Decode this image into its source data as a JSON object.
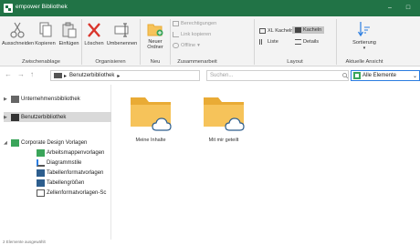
{
  "window": {
    "title": "empower Bibliothek",
    "controls": {
      "minimize": "–",
      "maximize": "□"
    }
  },
  "ribbon": {
    "clipboard": {
      "cut": "Ausschneiden",
      "copy": "Kopieren",
      "paste": "Einfügen",
      "group_label": "Zwischenablage"
    },
    "organize": {
      "delete": "Löschen",
      "rename": "Umbenennen",
      "group_label": "Organisieren"
    },
    "new": {
      "new_folder_line1": "Neuer",
      "new_folder_line2": "Ordner",
      "group_label": "Neu"
    },
    "collaboration": {
      "permissions": "Berechtigungen",
      "copy_link": "Link kopieren",
      "offline": "Offline",
      "group_label": "Zusammenarbeit"
    },
    "layout": {
      "xl_tiles": "XL Kacheln",
      "tiles": "Kacheln",
      "list": "Liste",
      "details": "Details",
      "group_label": "Layout"
    },
    "current_view": {
      "sort": "Sortierung",
      "group_label": "Aktuelle Ansicht"
    }
  },
  "addressbar": {
    "back": "←",
    "forward": "→",
    "up": "↑",
    "breadcrumb": "Benutzerbibliothek",
    "breadcrumb_separator": "▸",
    "search_placeholder": "Suchen...",
    "filter_value": "Alle Elemente"
  },
  "sidebar": {
    "items": [
      {
        "label": "Unternehmensbibliothek"
      },
      {
        "label": "Benutzerbibliothek"
      },
      {
        "label": "Corporate Design Vorlagen"
      },
      {
        "label": "Arbeitsmappenvorlagen"
      },
      {
        "label": "Diagrammstile"
      },
      {
        "label": "Tabellenformatvorlagen"
      },
      {
        "label": "Tabellengrößen"
      },
      {
        "label": "Zellenformatvorlagen-Sc"
      }
    ]
  },
  "content": {
    "folders": [
      {
        "label": "Meine Inhalte"
      },
      {
        "label": "Mit mir geteilt"
      }
    ]
  },
  "status": {
    "text": "2 Elemente ausgewählt"
  },
  "colors": {
    "titlebar": "#217346",
    "folder": "#f6c35a",
    "folder_dark": "#e9ab35",
    "accent_blue": "#2b7de0",
    "delete_red": "#d9342b"
  }
}
